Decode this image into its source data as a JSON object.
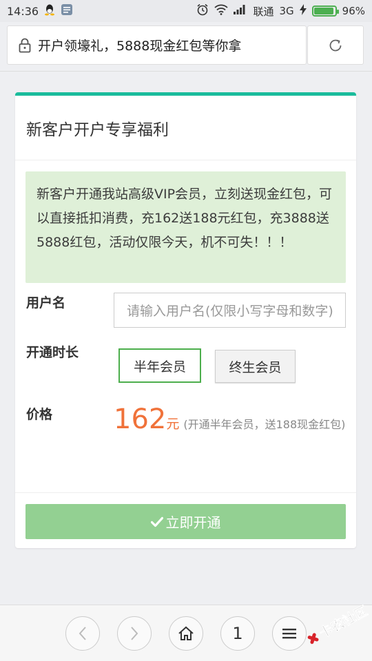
{
  "status": {
    "time": "14:36",
    "carrier": "联通",
    "network": "3G",
    "battery": "96%",
    "battery_level": 0.96
  },
  "browser": {
    "url_title": "开户领壕礼，5888现金红包等你拿"
  },
  "card": {
    "title": "新客户开户专享福利",
    "notice": "新客户开通我站高级VIP会员，立刻送现金红包，可以直接抵扣消费，充162送188元红包，充3888送5888红包，活动仅限今天，机不可失！！！",
    "username_label": "用户名",
    "username_placeholder": "请输入用户名(仅限小写字母和数字)",
    "duration_label": "开通时长",
    "option_half": "半年会员",
    "option_life": "终生会员",
    "price_label": "价格",
    "price_value": "162",
    "price_unit": "元",
    "price_note": "(开通半年会员，送188现金红包)",
    "submit_label": "立即开通"
  },
  "nav": {
    "tab_count": "1"
  },
  "watermark": {
    "text": "卡农社区"
  },
  "colors": {
    "accent_top": "#1abc9c",
    "price": "#f0723a",
    "submit": "#93d092",
    "notice_bg": "#dff0d8"
  }
}
